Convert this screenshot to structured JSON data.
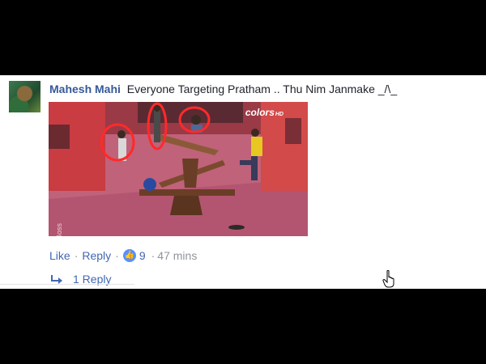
{
  "comment": {
    "author": "Mahesh Mahi",
    "text": "Everyone Targeting Pratham .. Thu Nim Janmake _/\\_",
    "media": {
      "channel_logo": "colors",
      "channel_sub": "HD",
      "watermark": "@OllePrathamBigBoss"
    },
    "actions": {
      "like_label": "Like",
      "separator": "·",
      "reply_label": "Reply",
      "like_icon": "thumbs-up-icon",
      "like_count": "9",
      "time": "47 mins"
    },
    "replies": {
      "icon": "reply-arrow-icon",
      "label": "1 Reply"
    }
  },
  "colors": {
    "author_link": "#365899",
    "action_link": "#4267b2",
    "muted": "#90949c",
    "like_badge": "#5890ff",
    "background_frame": "#000000"
  }
}
